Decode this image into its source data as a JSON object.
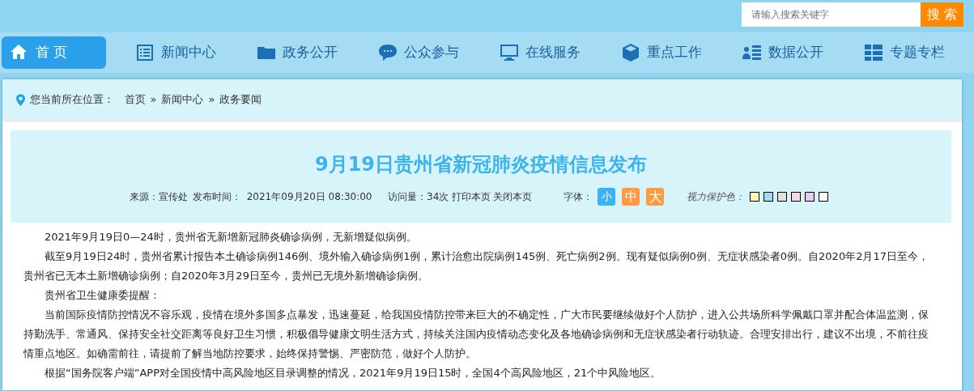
{
  "search": {
    "placeholder": "请输入搜索关键字",
    "button": "搜 索"
  },
  "nav": [
    {
      "label": "首 页",
      "selected": true
    },
    {
      "label": "新闻中心",
      "selected": false
    },
    {
      "label": "政务公开",
      "selected": false
    },
    {
      "label": "公众参与",
      "selected": false
    },
    {
      "label": "在线服务",
      "selected": false
    },
    {
      "label": "重点工作",
      "selected": false
    },
    {
      "label": "数据公开",
      "selected": false
    },
    {
      "label": "专题专栏",
      "selected": false
    }
  ],
  "breadcrumb": {
    "label": "您当前所在位置：",
    "items": [
      "首页",
      "新闻中心",
      "政务要闻"
    ],
    "separator": "»"
  },
  "article": {
    "title": "9月19日贵州省新冠肺炎疫情信息发布",
    "source": "来源：宣传处",
    "published_label": "发布时间：",
    "published": "2021年09月20日 08:30:00",
    "views": "访问量：34次",
    "print": "打印本页",
    "close": "关闭本页",
    "font_label": "字体：",
    "font_sizes": [
      {
        "label": "小",
        "selected": true
      },
      {
        "label": "中",
        "selected": false
      },
      {
        "label": "大",
        "selected": false
      }
    ],
    "eye_care_label": "视力保护色：",
    "eye_care_colors": [
      {
        "color": "#fff9b3"
      },
      {
        "color": "#a0dcf4"
      },
      {
        "color": "#e0e0e0"
      },
      {
        "color": "#f9d5dd"
      },
      {
        "color": "#e6cbf6"
      },
      {
        "color": "#ffffff"
      }
    ],
    "paragraphs": [
      "2021年9月19日0—24时，贵州省无新增新冠肺炎确诊病例，无新增疑似病例。",
      "截至9月19日24时，贵州省累计报告本土确诊病例146例、境外输入确诊病例1例，累计治愈出院病例145例、死亡病例2例。现有疑似病例0例、无症状感染者0例。自2020年2月17日至今，贵州省已无本土新增确诊病例；自2020年3月29日至今，贵州已无境外新增确诊病例。",
      "贵州省卫生健康委提醒：",
      "当前国际疫情防控情况不容乐观，疫情在境外多国多点暴发，迅速蔓延，给我国疫情防控带来巨大的不确定性，广大市民要继续做好个人防护，进入公共场所科学佩戴口罩并配合体温监测，保持勤洗手、常通风、保持安全社交距离等良好卫生习惯，积极倡导健康文明生活方式，持续关注国内疫情动态变化及各地确诊病例和无症状感染者行动轨迹。合理安排出行，建议不出境，不前往疫情重点地区。如确需前往，请提前了解当地防控要求，始终保持警惕、严密防范，做好个人防护。",
      "根据“国务院客户端”APP对全国疫情中高风险地区目录调整的情况，2021年9月19日15时，全国4个高风险地区，21个中风险地区。"
    ]
  }
}
